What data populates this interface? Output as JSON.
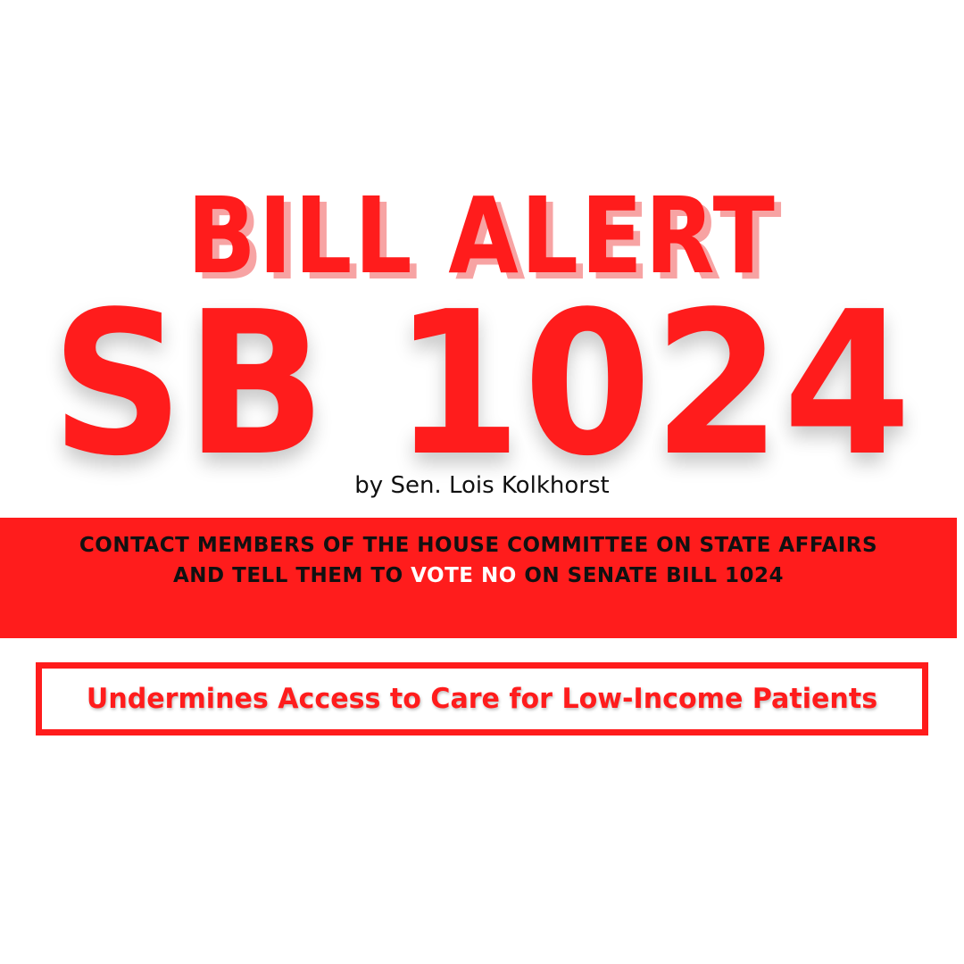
{
  "colors": {
    "accent_red": "#ff1c1c",
    "shadow_pink": "#f7a3a3",
    "text_dark": "#111111",
    "background": "#ffffff"
  },
  "headline": {
    "alert": "BILL ALERT",
    "bill_number": "SB 1024"
  },
  "byline": "by Sen. Lois Kolkhorst",
  "call_to_action": {
    "line1": "CONTACT MEMBERS OF THE HOUSE COMMITTEE ON STATE AFFAIRS",
    "line2_prefix": "AND TELL THEM TO ",
    "line2_emphasis": "VOTE NO",
    "line2_suffix": " ON SENATE BILL 1024"
  },
  "impact_statement": "Undermines Access to Care for Low-Income Patients"
}
